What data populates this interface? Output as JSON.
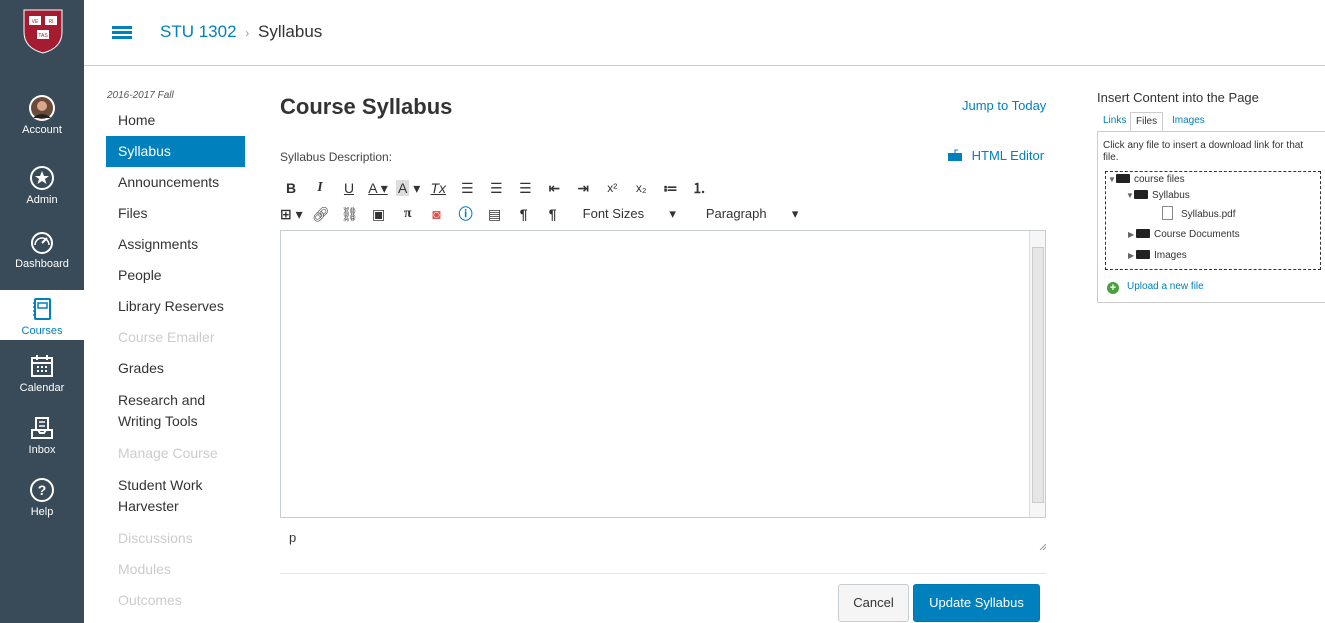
{
  "global_nav": {
    "items": [
      {
        "label": "Account",
        "icon": "account-avatar-icon"
      },
      {
        "label": "Admin",
        "icon": "shield-star-icon"
      },
      {
        "label": "Dashboard",
        "icon": "speedometer-icon"
      },
      {
        "label": "Courses",
        "icon": "book-icon"
      },
      {
        "label": "Calendar",
        "icon": "calendar-icon"
      },
      {
        "label": "Inbox",
        "icon": "inbox-icon"
      },
      {
        "label": "Help",
        "icon": "question-icon"
      }
    ],
    "logo_text": "VE RI TAS"
  },
  "header": {
    "course": "STU 1302",
    "page": "Syllabus",
    "separator": "›"
  },
  "course_nav": {
    "term": "2016-2017 Fall",
    "items": [
      {
        "label": "Home"
      },
      {
        "label": "Syllabus"
      },
      {
        "label": "Announcements"
      },
      {
        "label": "Files"
      },
      {
        "label": "Assignments"
      },
      {
        "label": "People"
      },
      {
        "label": "Library Reserves"
      },
      {
        "label": "Course Emailer"
      },
      {
        "label": "Grades"
      },
      {
        "label": "Research and Writing Tools"
      },
      {
        "label": "Manage Course"
      },
      {
        "label": "Student Work Harvester"
      },
      {
        "label": "Discussions"
      },
      {
        "label": "Modules"
      },
      {
        "label": "Outcomes"
      }
    ]
  },
  "main": {
    "title": "Course Syllabus",
    "jump_to_today": "Jump to Today",
    "description_label": "Syllabus Description:",
    "html_editor": "HTML Editor",
    "toolbar": {
      "font_sizes": "Font Sizes",
      "paragraph": "Paragraph",
      "bold": "B",
      "italic": "I",
      "underline": "U",
      "text_color": "A",
      "bg_color": "A",
      "clear": "Tx",
      "superscript": "x²",
      "subscript": "x₂",
      "pi": "π",
      "pilcrow": "¶"
    },
    "path_indicator": "p",
    "cancel": "Cancel",
    "update": "Update Syllabus"
  },
  "sidebar": {
    "heading": "Insert Content into the Page",
    "tabs": [
      {
        "label": "Links"
      },
      {
        "label": "Files"
      },
      {
        "label": "Images"
      }
    ],
    "hint": "Click any file to insert a download link for that file.",
    "tree": {
      "root": "course files",
      "syllabus_folder": "Syllabus",
      "syllabus_file": "Syllabus.pdf",
      "course_documents": "Course Documents",
      "images": "Images"
    },
    "upload": "Upload a new file"
  },
  "colors": {
    "nav_bg": "#394b58",
    "accent": "#0081bd",
    "disabled": "#cccccc"
  }
}
